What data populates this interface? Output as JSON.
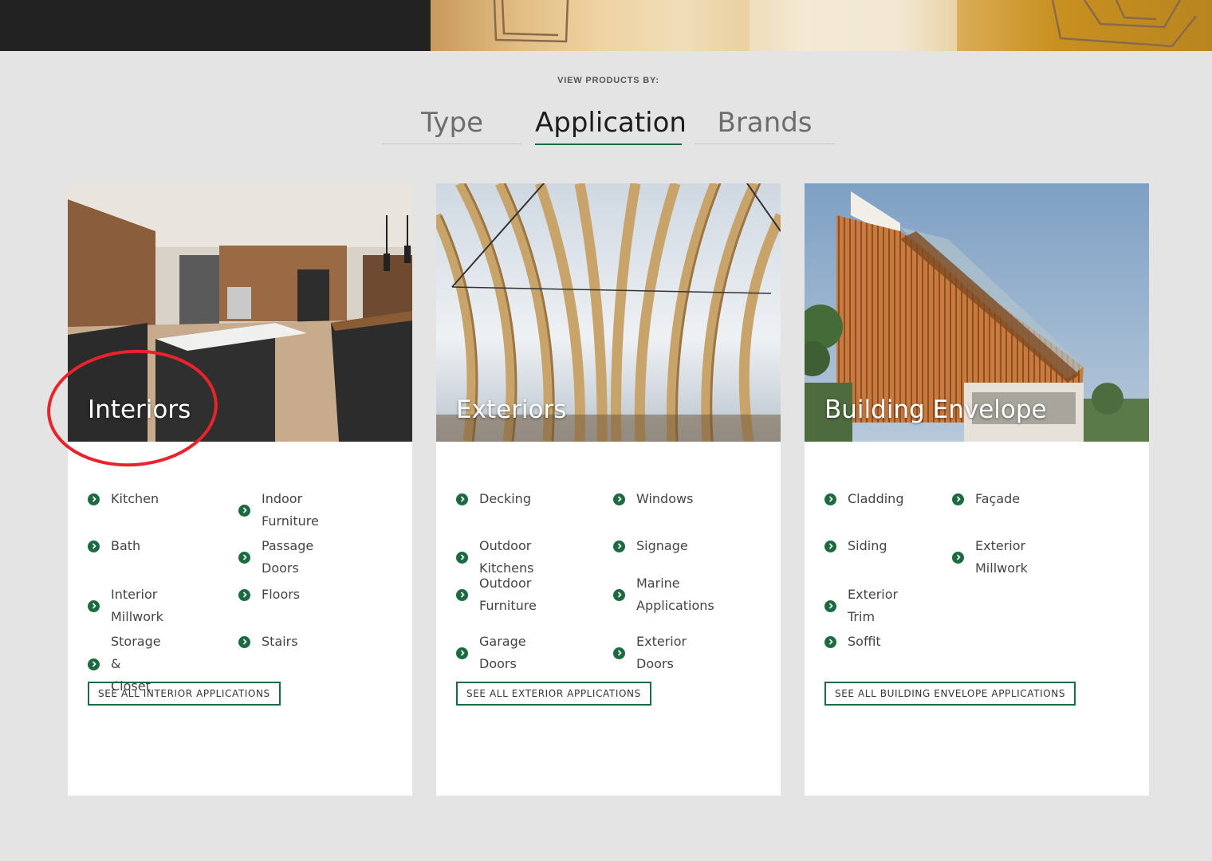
{
  "view_label": "VIEW PRODUCTS BY:",
  "tabs": [
    {
      "label": "Type",
      "active": false
    },
    {
      "label": "Application",
      "active": true
    },
    {
      "label": "Brands",
      "active": false
    }
  ],
  "cards": [
    {
      "title": "Interiors",
      "col1": [
        "Kitchen",
        "Bath",
        "Interior Millwork",
        "Storage & Closet"
      ],
      "col2": [
        "Indoor Furniture",
        "Passage Doors",
        "Floors",
        "Stairs"
      ],
      "see_all": "SEE ALL INTERIOR APPLICATIONS"
    },
    {
      "title": "Exteriors",
      "col1": [
        "Decking",
        "Outdoor Kitchens",
        "Outdoor Furniture",
        "Garage Doors"
      ],
      "col2": [
        "Windows",
        "Signage",
        "Marine Applications",
        "Exterior Doors"
      ],
      "see_all": "SEE ALL EXTERIOR APPLICATIONS"
    },
    {
      "title": "Building Envelope",
      "col1": [
        "Cladding",
        "Siding",
        "Exterior Trim",
        "Soffit"
      ],
      "col2": [
        "Façade",
        "Exterior Millwork"
      ],
      "see_all": "SEE ALL BUILDING ENVELOPE APPLICATIONS"
    }
  ],
  "colors": {
    "accent_green": "#1b6b40",
    "annotation_red": "#e8232b",
    "page_bg": "#e4e4e4"
  },
  "icons": {
    "link_bullet": "chevron-right-circle-icon"
  }
}
